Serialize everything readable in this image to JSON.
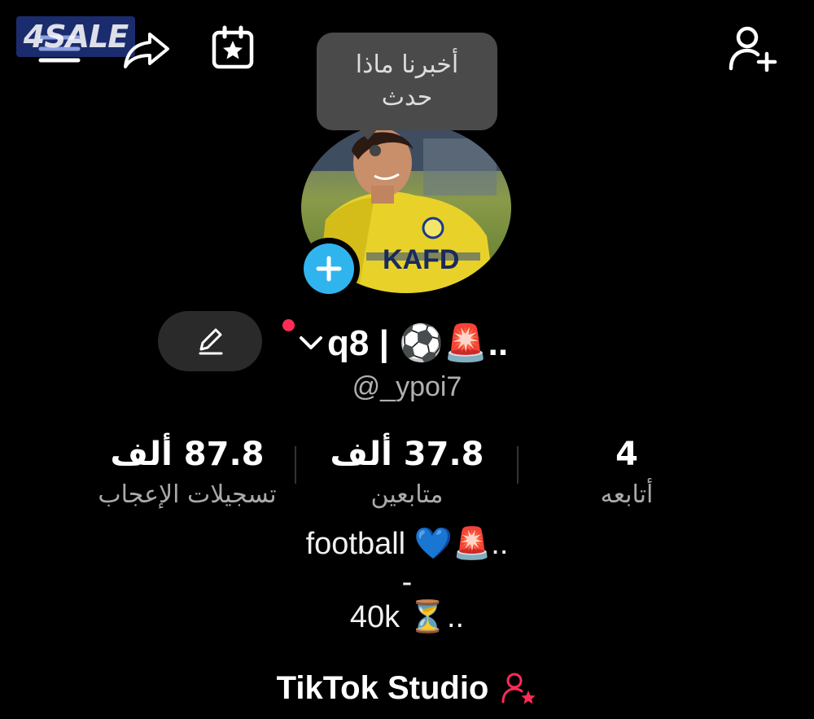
{
  "watermark": {
    "text": "4SALE"
  },
  "tooltip": {
    "text": "أخبرنا ماذا حدث"
  },
  "profile": {
    "display_name": "q8 | ⚽🚨..",
    "handle": "@_ypoi7"
  },
  "stats": [
    {
      "value": "87.8 ألف",
      "label": "تسجيلات الإعجاب"
    },
    {
      "value": "37.8 ألف",
      "label": "متابعين"
    },
    {
      "value": "4",
      "label": "أتابعه"
    }
  ],
  "bio": {
    "line1": "football 💙🚨..",
    "line2": "-",
    "line3": "40k ⏳.."
  },
  "studio": {
    "label": "TikTok Studio"
  },
  "colors": {
    "accent_blue": "#30b4ee",
    "notification_red": "#fe2c55",
    "studio_icon_pink": "#fe2c55"
  },
  "icons": [
    "menu-icon",
    "share-icon",
    "calendar-star-icon",
    "add-friend-icon",
    "pencil-icon",
    "chevron-down-icon",
    "plus-icon",
    "studio-person-star-icon"
  ]
}
